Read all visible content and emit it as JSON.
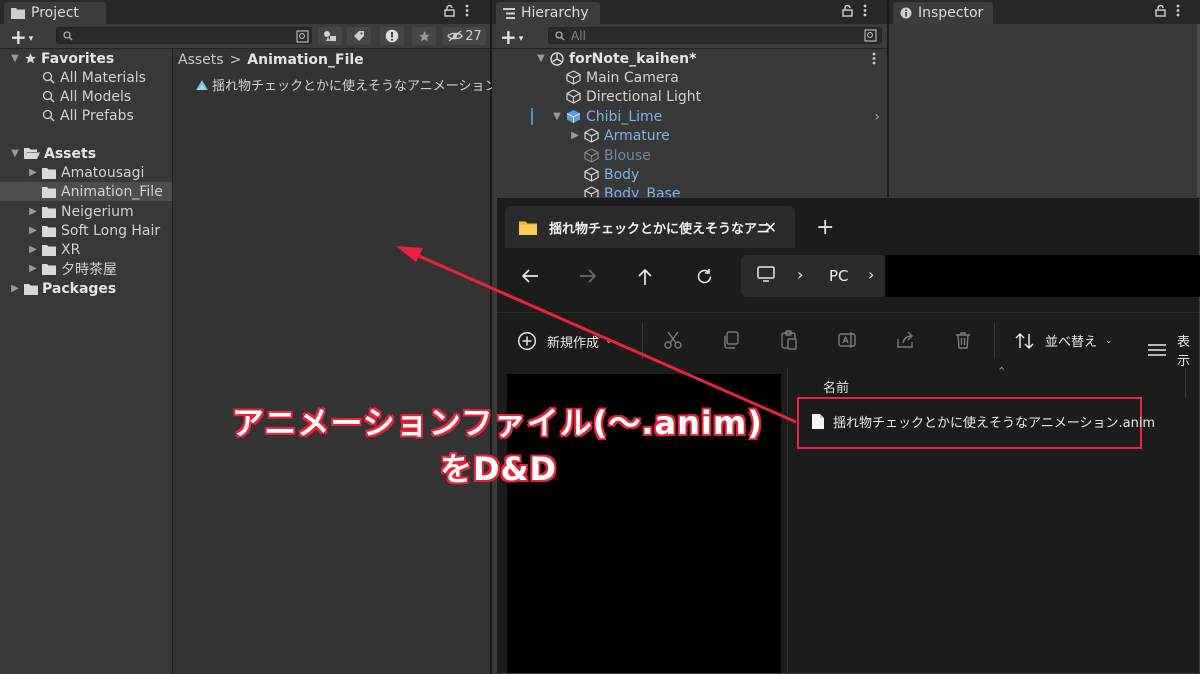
{
  "project": {
    "tab_label": "Project",
    "search_placeholder": "",
    "hidden_count": "27",
    "tree": {
      "favorites_label": "Favorites",
      "favorites": [
        "All Materials",
        "All Models",
        "All Prefabs"
      ],
      "assets_label": "Assets",
      "assets": [
        "Amatousagi",
        "Animation_File",
        "Neigerium",
        "Soft Long Hair",
        "XR",
        "夕時茶屋"
      ],
      "packages_label": "Packages"
    },
    "breadcrumb": {
      "root": "Assets",
      "separator": ">",
      "current": "Animation_File"
    },
    "files": [
      "揺れ物チェックとかに使えそうなアニメーション"
    ]
  },
  "hierarchy": {
    "tab_label": "Hierarchy",
    "search_placeholder": "All",
    "scene_name": "forNote_kaihen*",
    "items": [
      {
        "label": "Main Camera",
        "style": "normal"
      },
      {
        "label": "Directional Light",
        "style": "normal"
      },
      {
        "label": "Chibi_Lime",
        "style": "prefab"
      },
      {
        "label": "Armature",
        "style": "prefab"
      },
      {
        "label": "Blouse",
        "style": "disabled"
      },
      {
        "label": "Body",
        "style": "prefab"
      },
      {
        "label": "Body_Base",
        "style": "prefab"
      }
    ]
  },
  "inspector": {
    "tab_label": "Inspector"
  },
  "explorer": {
    "tab_title": "揺れ物チェックとかに使えそうなアニ",
    "address": {
      "root": "PC"
    },
    "commands": {
      "new_label": "新規作成",
      "sort_label": "並べ替え",
      "view_label": "表示"
    },
    "column_name": "名前",
    "file_name": "揺れ物チェックとかに使えそうなアニメーション.anim"
  },
  "annotation": {
    "line1": "アニメーションファイル(～.anim)",
    "line2": "をD&D"
  },
  "colors": {
    "annotation_red": "#e8233b",
    "prefab_blue": "#7cb2ef",
    "unity_panel": "#383838"
  }
}
